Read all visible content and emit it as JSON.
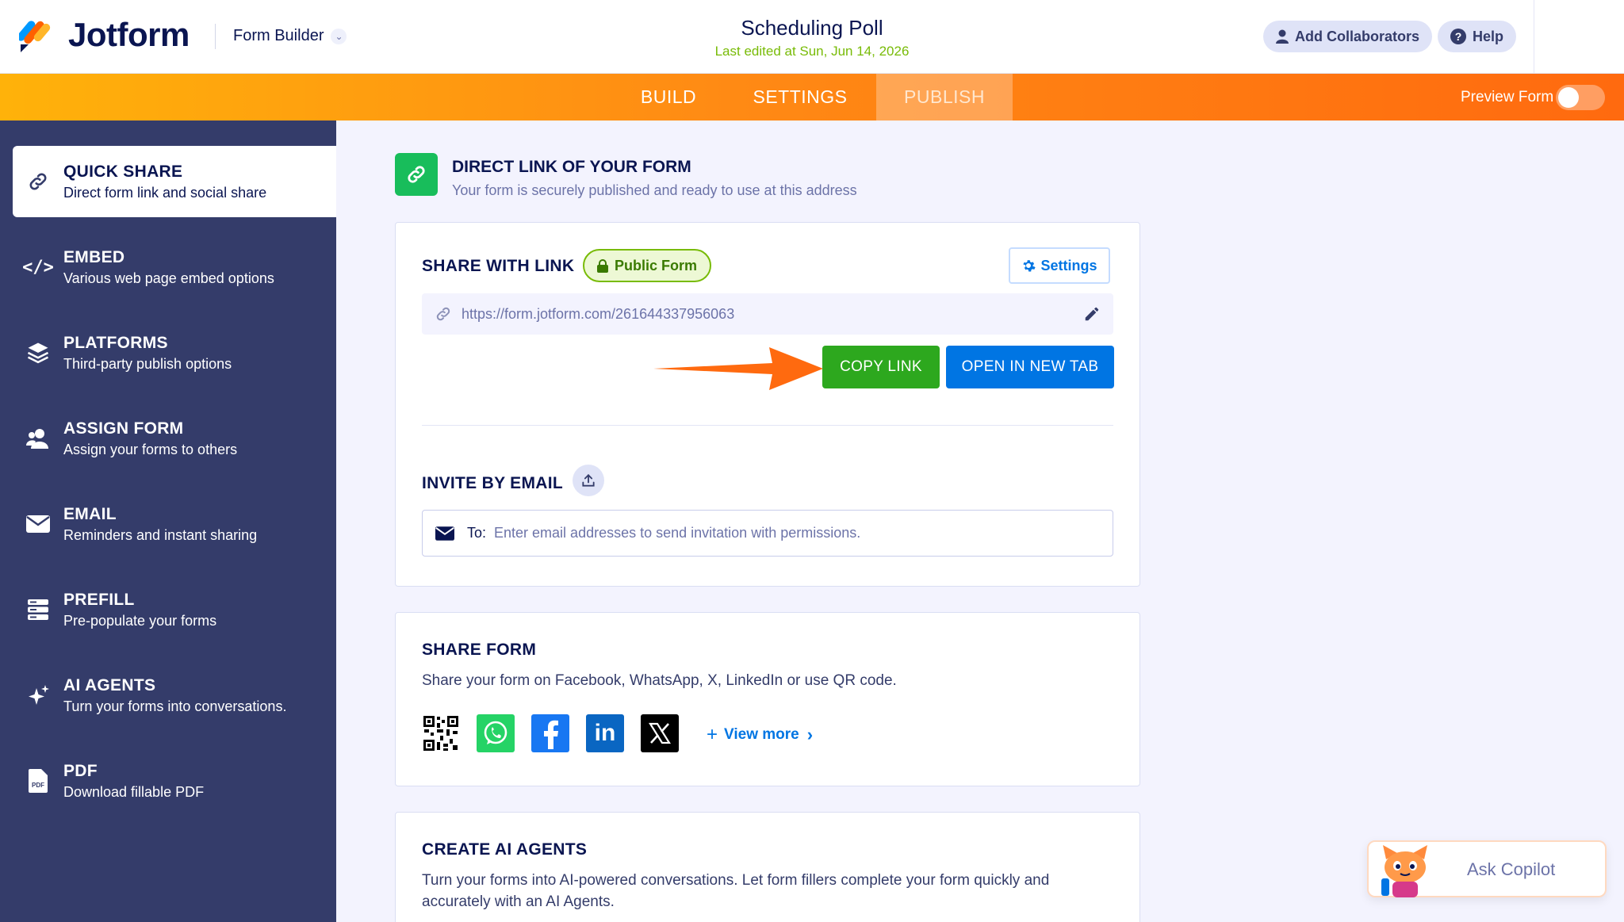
{
  "header": {
    "logo": "Jotform",
    "builder_label": "Form Builder",
    "form_title": "Scheduling Poll",
    "last_edited": "Last edited at Sun, Jun 14, 2026",
    "add_collaborators": "Add Collaborators",
    "help": "Help"
  },
  "tabs": [
    {
      "label": "BUILD",
      "active": false
    },
    {
      "label": "SETTINGS",
      "active": false
    },
    {
      "label": "PUBLISH",
      "active": true
    }
  ],
  "preview": {
    "label": "Preview Form",
    "on": false
  },
  "sidebar": {
    "items": [
      {
        "title": "QUICK SHARE",
        "sub": "Direct form link and social share",
        "icon": "link-icon",
        "active": true
      },
      {
        "title": "EMBED",
        "sub": "Various web page embed options",
        "icon": "code-icon"
      },
      {
        "title": "PLATFORMS",
        "sub": "Third-party publish options",
        "icon": "layers-icon"
      },
      {
        "title": "ASSIGN FORM",
        "sub": "Assign your forms to others",
        "icon": "users-icon"
      },
      {
        "title": "EMAIL",
        "sub": "Reminders and instant sharing",
        "icon": "envelope-icon"
      },
      {
        "title": "PREFILL",
        "sub": "Pre-populate your forms",
        "icon": "database-icon"
      },
      {
        "title": "AI AGENTS",
        "sub": "Turn your forms into conversations.",
        "icon": "sparkle-icon"
      },
      {
        "title": "PDF",
        "sub": "Download fillable PDF",
        "icon": "pdf-icon"
      }
    ]
  },
  "direct_link": {
    "title": "DIRECT LINK OF YOUR FORM",
    "subtitle": "Your form is securely published and ready to use at this address"
  },
  "share_link": {
    "title": "SHARE WITH LINK",
    "badge": "Public Form",
    "settings": "Settings",
    "url": "https://form.jotform.com/261644337956063",
    "copy": "COPY LINK",
    "open": "OPEN IN NEW TAB"
  },
  "invite": {
    "title": "INVITE BY EMAIL",
    "to_label": "To:",
    "placeholder": "Enter email addresses to send invitation with permissions."
  },
  "share_form": {
    "title": "SHARE FORM",
    "desc": "Share your form on Facebook, WhatsApp, X, LinkedIn or use QR code.",
    "view_more": "View more"
  },
  "ai_agents": {
    "title": "CREATE AI AGENTS",
    "desc": "Turn your forms into AI-powered conversations. Let form fillers complete your form quickly and accurately with an AI Agents."
  },
  "copilot": {
    "label": "Ask Copilot"
  },
  "colors": {
    "accent_orange": "#ff6a0f",
    "green": "#2da81e",
    "blue": "#0075e3",
    "navy": "#343c6a"
  }
}
